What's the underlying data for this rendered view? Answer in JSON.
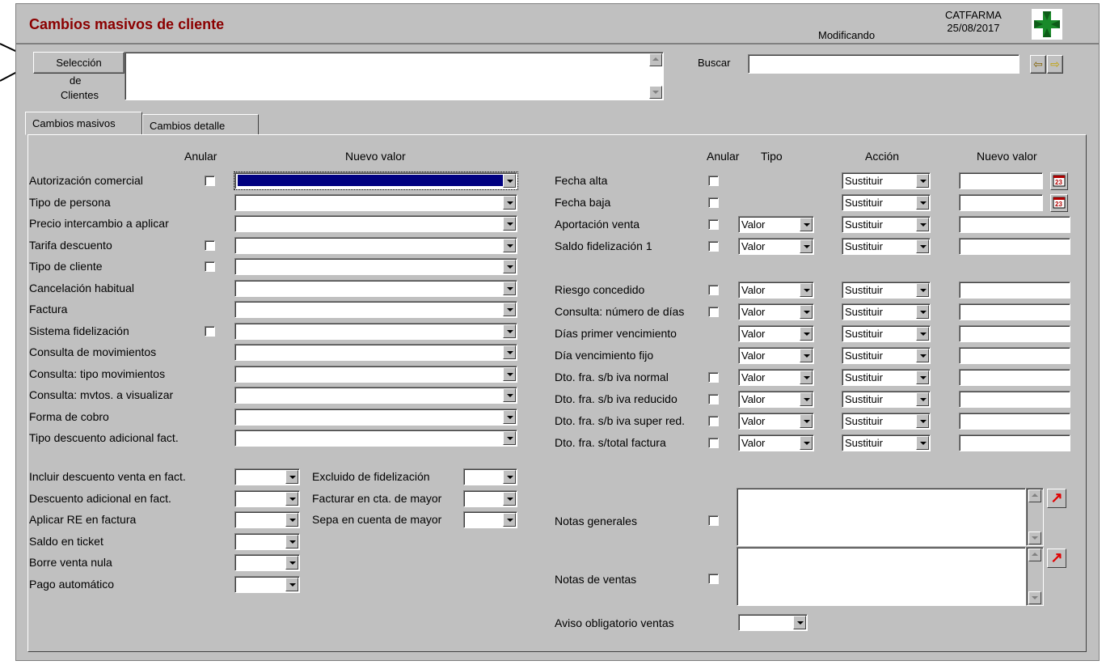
{
  "title": "Cambios masivos de cliente",
  "status": "Modificando",
  "company": "CATFARMA",
  "date": "25/08/2017",
  "seleccion": {
    "line1": "Selección",
    "line2": "de",
    "line3": "Clientes"
  },
  "buscar_label": "Buscar",
  "tabs": [
    {
      "label": "Cambios masivos"
    },
    {
      "label": "Cambios detalle"
    }
  ],
  "left": {
    "header_anular": "Anular",
    "header_nuevo": "Nuevo valor",
    "rows": [
      {
        "label": "Autorización comercial"
      },
      {
        "label": "Tipo de persona"
      },
      {
        "label": "Precio intercambio a aplicar"
      },
      {
        "label": "Tarifa descuento"
      },
      {
        "label": "Tipo de cliente"
      },
      {
        "label": "Cancelación habitual"
      },
      {
        "label": "Factura"
      },
      {
        "label": "Sistema fidelización"
      },
      {
        "label": "Consulta de movimientos"
      },
      {
        "label": "Consulta: tipo movimientos"
      },
      {
        "label": "Consulta: mvtos. a visualizar"
      },
      {
        "label": "Forma de cobro"
      },
      {
        "label": "Tipo descuento adicional fact."
      }
    ],
    "short_rows": [
      {
        "label": "Incluir descuento venta en fact."
      },
      {
        "label": "Descuento adicional en fact."
      },
      {
        "label": "Aplicar RE en factura"
      },
      {
        "label": "Saldo en ticket"
      },
      {
        "label": "Borre venta nula"
      },
      {
        "label": "Pago automático"
      }
    ],
    "mid_rows": [
      {
        "label": "Excluido de fidelización"
      },
      {
        "label": "Facturar en cta. de mayor"
      },
      {
        "label": "Sepa en cuenta de mayor"
      }
    ]
  },
  "right": {
    "header_anular": "Anular",
    "header_tipo": "Tipo",
    "header_accion": "Acción",
    "header_nuevo": "Nuevo valor",
    "tipo_value": "Valor",
    "accion_value": "Sustituir",
    "rows": [
      {
        "label": "Fecha alta"
      },
      {
        "label": "Fecha baja"
      },
      {
        "label": "Aportación venta"
      },
      {
        "label": "Saldo fidelización 1"
      },
      {
        "label": "Riesgo concedido"
      },
      {
        "label": "Consulta: número de días"
      },
      {
        "label": "Días primer vencimiento"
      },
      {
        "label": "Día vencimiento fijo"
      },
      {
        "label": "Dto. fra. s/b iva normal"
      },
      {
        "label": "Dto. fra. s/b iva reducido"
      },
      {
        "label": "Dto. fra. s/b iva super red."
      },
      {
        "label": "Dto. fra. s/total factura"
      }
    ],
    "notas_generales": "Notas generales",
    "notas_ventas": "Notas de ventas",
    "aviso": "Aviso obligatorio ventas"
  },
  "colors": {
    "title": "#8b0000",
    "face": "#c0c0c0",
    "cross": "#1a8a2a"
  },
  "icons": [
    "calendar-icon",
    "arrow-left-icon",
    "arrow-right-icon",
    "open-editor-icon"
  ]
}
